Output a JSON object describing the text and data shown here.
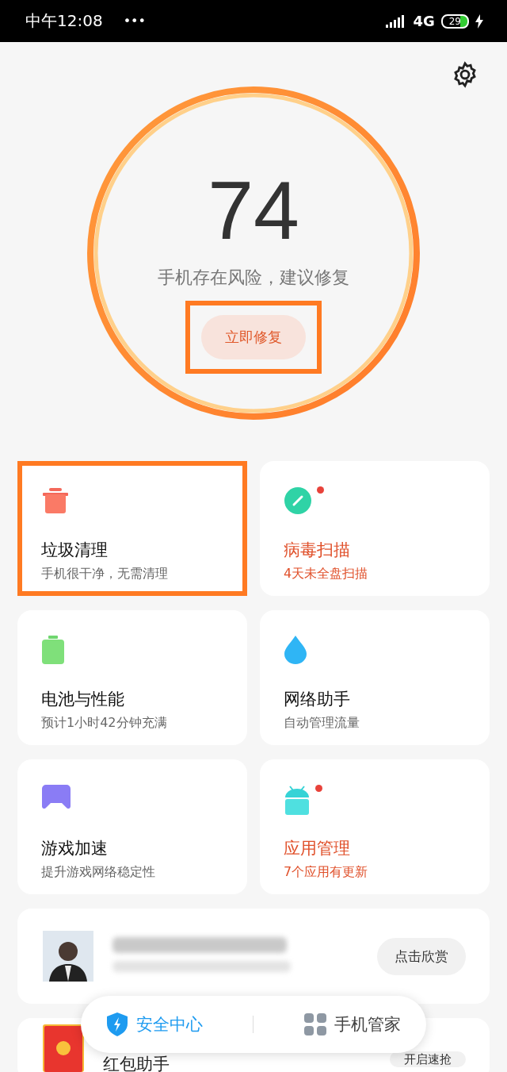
{
  "status_bar": {
    "time": "中午12:08",
    "more": "•••",
    "network": "4G",
    "battery": "29"
  },
  "score": {
    "value": "74",
    "message": "手机存在风险，建议修复",
    "button": "立即修复",
    "highlighted": true
  },
  "tiles": [
    {
      "kind": "trash",
      "title": "垃圾清理",
      "subtitle": "手机很干净，无需清理",
      "alert": false,
      "highlighted": true
    },
    {
      "kind": "scan",
      "title": "病毒扫描",
      "subtitle": "4天未全盘扫描",
      "alert": true,
      "highlighted": false
    },
    {
      "kind": "battery",
      "title": "电池与性能",
      "subtitle": "预计1小时42分钟充满",
      "alert": false,
      "highlighted": false
    },
    {
      "kind": "drop",
      "title": "网络助手",
      "subtitle": "自动管理流量",
      "alert": false,
      "highlighted": false
    },
    {
      "kind": "game",
      "title": "游戏加速",
      "subtitle": "提升游戏网络稳定性",
      "alert": false,
      "highlighted": false
    },
    {
      "kind": "android",
      "title": "应用管理",
      "subtitle": "7个应用有更新",
      "alert": true,
      "highlighted": false
    }
  ],
  "feature_card": {
    "button": "点击欣赏"
  },
  "redpacket_card": {
    "title": "红包助手",
    "button": "开启速抢"
  },
  "bottom_nav": [
    {
      "label": "安全中心",
      "selected": true
    },
    {
      "label": "手机管家",
      "selected": false
    }
  ]
}
